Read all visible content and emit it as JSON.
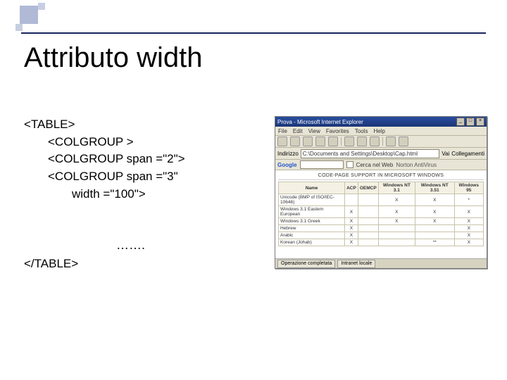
{
  "title": "Attributo width",
  "code": {
    "open": "<TABLE>",
    "l1": "<COLGROUP >",
    "l2": "<COLGROUP span =\"2\">",
    "l3": "<COLGROUP span =\"3\"",
    "l4": "width =\"100\">",
    "dots": "…….",
    "close": "</TABLE>"
  },
  "browser": {
    "title": "Prova - Microsoft Internet Explorer",
    "menus": [
      "File",
      "Edit",
      "View",
      "Favorites",
      "Tools",
      "Help"
    ],
    "addr_label": "Indirizzo",
    "addr": "C:\\Documents and Settings\\Desktop\\Cap.html",
    "vai": "Vai",
    "links": "Collegamenti",
    "norton": "Norton AntiVirus",
    "google": "Google",
    "g_search": "Cerca nel Web",
    "page_title": "CODE-PAGE SUPPORT IN MICROSOFT WINDOWS",
    "cols": [
      "Name",
      "ACP",
      "OEMCP",
      "Windows NT 3.1",
      "Windows NT 3.51",
      "Windows 95"
    ],
    "rows": [
      [
        "Unicode (BMP of ISO/IEC-10646)",
        "",
        "",
        "X",
        "X",
        "*"
      ],
      [
        "Windows 3.1 Eastern European",
        "X",
        "",
        "X",
        "X",
        "X"
      ],
      [
        "Windows 3.1 Greek",
        "X",
        "",
        "X",
        "X",
        "X"
      ],
      [
        "Hebrew",
        "X",
        "",
        "",
        "",
        "X"
      ],
      [
        "Arabic",
        "X",
        "",
        "",
        "",
        "X"
      ],
      [
        "Korean (Johab)",
        "X",
        "",
        "",
        "**",
        "X"
      ]
    ],
    "taskbar_items": [
      "Operazione completata",
      "Intranet locale"
    ]
  }
}
